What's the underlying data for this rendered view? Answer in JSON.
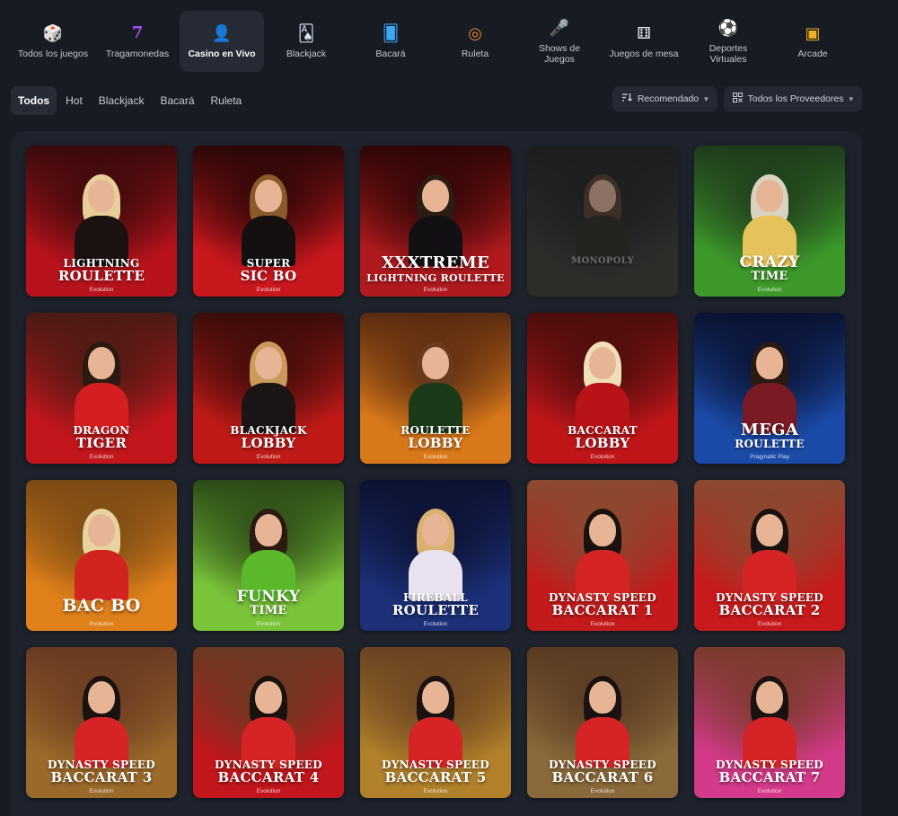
{
  "categories": [
    {
      "label": "Todos los juegos",
      "icon": "dice-icon",
      "glyph": "🎲",
      "active": false
    },
    {
      "label": "Tragamonedas",
      "icon": "slot-777-icon",
      "glyph": "7",
      "active": false
    },
    {
      "label": "Casino en Vivo",
      "icon": "live-dealer-icon",
      "glyph": "👤",
      "active": true
    },
    {
      "label": "Blackjack",
      "icon": "playing-card-icon",
      "glyph": "🂡",
      "active": false
    },
    {
      "label": "Bacará",
      "icon": "baccarat-cards-icon",
      "glyph": "🂠",
      "active": false
    },
    {
      "label": "Ruleta",
      "icon": "roulette-wheel-icon",
      "glyph": "◎",
      "active": false
    },
    {
      "label": "Shows de\nJuegos",
      "icon": "microphone-icon",
      "glyph": "🎤",
      "active": false
    },
    {
      "label": "Juegos de mesa",
      "icon": "table-dice-icon",
      "glyph": "⚅",
      "active": false
    },
    {
      "label": "Deportes\nVirtuales",
      "icon": "soccer-ball-icon",
      "glyph": "⚽",
      "active": false
    },
    {
      "label": "Arcade",
      "icon": "arcade-cube-icon",
      "glyph": "▣",
      "active": false
    }
  ],
  "filters": {
    "tabs": [
      "Todos",
      "Hot",
      "Blackjack",
      "Bacará",
      "Ruleta"
    ],
    "active_tab": "Todos",
    "sort_label": "Recomendado",
    "provider_label": "Todos los Proveedores"
  },
  "games": [
    {
      "line1": "LIGHTNING",
      "line2": "ROULETTE",
      "provider": "Evolution",
      "bg": "#b8131c",
      "bg2": "#3a0a0c",
      "hair": "#e8cf9a",
      "outfit": "#1b1111",
      "style": "normal"
    },
    {
      "line1": "SUPER",
      "line2": "SIC BO",
      "provider": "Evolution",
      "bg": "#c9171e",
      "bg2": "#2a0707",
      "hair": "#8a5a2b",
      "outfit": "#141010",
      "style": "normal"
    },
    {
      "line1": "XXXTREME",
      "line2": "LIGHTNING ROULETTE",
      "provider": "Evolution",
      "bg": "#b01a1e",
      "bg2": "#2e0606",
      "hair": "#2b1c14",
      "outfit": "#131013",
      "style": "xxx"
    },
    {
      "line1": "",
      "line2": "MONOPOLY",
      "provider": "",
      "bg": "#3a3528",
      "bg2": "#1b1a16",
      "hair": "#5a3a22",
      "outfit": "#2a2418",
      "style": "faded"
    },
    {
      "line1": "CRAZY",
      "line2": "TIME",
      "provider": "Evolution",
      "bg": "#3d9a2a",
      "bg2": "#1f3a1c",
      "hair": "#d9d2c2",
      "outfit": "#e6c25a",
      "style": "big1"
    },
    {
      "line1": "DRAGON",
      "line2": "TIGER",
      "provider": "Evolution",
      "bg": "#c2161c",
      "bg2": "#4a1a14",
      "hair": "#2a1a12",
      "outfit": "#d41e22",
      "style": "normal"
    },
    {
      "line1": "BLACKJACK",
      "line2": "LOBBY",
      "provider": "Evolution",
      "bg": "#bf1a18",
      "bg2": "#3a0c0a",
      "hair": "#c99a5a",
      "outfit": "#1a1414",
      "style": "normal"
    },
    {
      "line1": "ROULETTE",
      "line2": "LOBBY",
      "provider": "Evolution",
      "bg": "#d9781a",
      "bg2": "#5a2b10",
      "hair": "#6a3a1c",
      "outfit": "#1a3a1a",
      "style": "normal"
    },
    {
      "line1": "BACCARAT",
      "line2": "LOBBY",
      "provider": "Evolution",
      "bg": "#c0161a",
      "bg2": "#4a0d0c",
      "hair": "#efe0b8",
      "outfit": "#b81418",
      "style": "normal"
    },
    {
      "line1": "MEGA",
      "line2": "ROULETTE",
      "provider": "Pragmatic Play",
      "bg": "#1b4aa8",
      "bg2": "#0a1230",
      "hair": "#2a1a12",
      "outfit": "#7a1a24",
      "style": "mega"
    },
    {
      "line1": "",
      "line2": "BAC BO",
      "provider": "Evolution",
      "bg": "#e0801a",
      "bg2": "#7a4a14",
      "hair": "#e8d2a0",
      "outfit": "#d2241e",
      "style": "bigone"
    },
    {
      "line1": "FUNKY",
      "line2": "TIME",
      "provider": "Evolution",
      "bg": "#7ac43a",
      "bg2": "#2c4a16",
      "hair": "#2a1a12",
      "outfit": "#5ab82a",
      "style": "big1"
    },
    {
      "line1": "FIREBALL",
      "line2": "ROULETTE",
      "provider": "Evolution",
      "bg": "#1c2f78",
      "bg2": "#0c1230",
      "hair": "#d8b070",
      "outfit": "#e8e2f0",
      "style": "normal"
    },
    {
      "line1": "DYNASTY SPEED",
      "line2": "BACCARAT 1",
      "provider": "Evolution",
      "bg": "#c41a1c",
      "bg2": "#8a4a30",
      "hair": "#1a1210",
      "outfit": "#d62426",
      "style": "dyn"
    },
    {
      "line1": "DYNASTY SPEED",
      "line2": "BACCARAT 2",
      "provider": "Evolution",
      "bg": "#c81a1c",
      "bg2": "#8a4a30",
      "hair": "#1a1210",
      "outfit": "#d62426",
      "style": "dyn"
    },
    {
      "line1": "DYNASTY SPEED",
      "line2": "BACCARAT 3",
      "provider": "Evolution",
      "bg": "#9a6a2a",
      "bg2": "#6a3a22",
      "hair": "#1a1210",
      "outfit": "#d62426",
      "style": "dyn"
    },
    {
      "line1": "DYNASTY SPEED",
      "line2": "BACCARAT 4",
      "provider": "Evolution",
      "bg": "#c2161c",
      "bg2": "#6a3a22",
      "hair": "#1a1210",
      "outfit": "#d62426",
      "style": "dyn"
    },
    {
      "line1": "DYNASTY SPEED",
      "line2": "BACCARAT 5",
      "provider": "Evolution",
      "bg": "#b0802a",
      "bg2": "#6a4222",
      "hair": "#1a1210",
      "outfit": "#d62426",
      "style": "dyn"
    },
    {
      "line1": "DYNASTY SPEED",
      "line2": "BACCARAT 6",
      "provider": "Evolution",
      "bg": "#8a6a3a",
      "bg2": "#5a3a22",
      "hair": "#1a1210",
      "outfit": "#d62426",
      "style": "dyn"
    },
    {
      "line1": "DYNASTY SPEED",
      "line2": "BACCARAT 7",
      "provider": "Evolution",
      "bg": "#d43a8a",
      "bg2": "#7a3a2a",
      "hair": "#1a1210",
      "outfit": "#d62426",
      "style": "dyn"
    }
  ]
}
